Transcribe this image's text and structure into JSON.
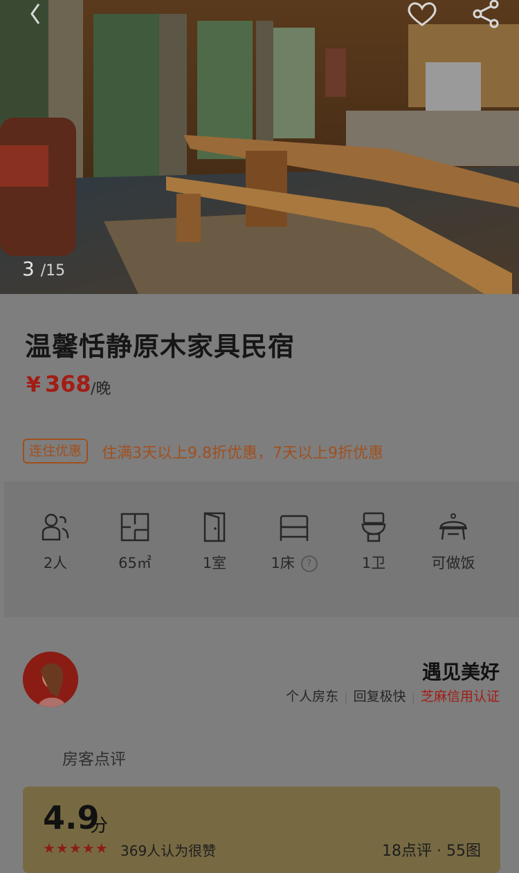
{
  "gallery": {
    "current": "3",
    "total": "/15"
  },
  "listing": {
    "title": "温馨恬静原木家具民宿",
    "price_symbol": "¥",
    "price": "368",
    "price_unit": "/晚",
    "promo_tag": "连住优惠",
    "promo_text": "住满3天以上9.8折优惠，7天以上9折优惠"
  },
  "facilities": [
    {
      "icon": "guests-icon",
      "label": "2人"
    },
    {
      "icon": "floorplan-icon",
      "label": "65㎡"
    },
    {
      "icon": "door-icon",
      "label": "1室"
    },
    {
      "icon": "bed-icon",
      "label": "1床"
    },
    {
      "icon": "toilet-icon",
      "label": "1卫"
    },
    {
      "icon": "cooking-icon",
      "label": "可做饭"
    }
  ],
  "host": {
    "name": "遇见美好",
    "tag1": "个人房东",
    "tag2": "回复极快",
    "tag3": "芝麻信用认证"
  },
  "reviews": {
    "section_title": "房客点评",
    "score": "4.9",
    "score_unit": "分",
    "stars": "★★★★★",
    "likes": "369人认为很赞",
    "counts": "18点评 · 55图"
  },
  "colors": {
    "price": "#a21d14",
    "promo": "#a0501f",
    "overlay_bg": "#7e7e7e"
  }
}
